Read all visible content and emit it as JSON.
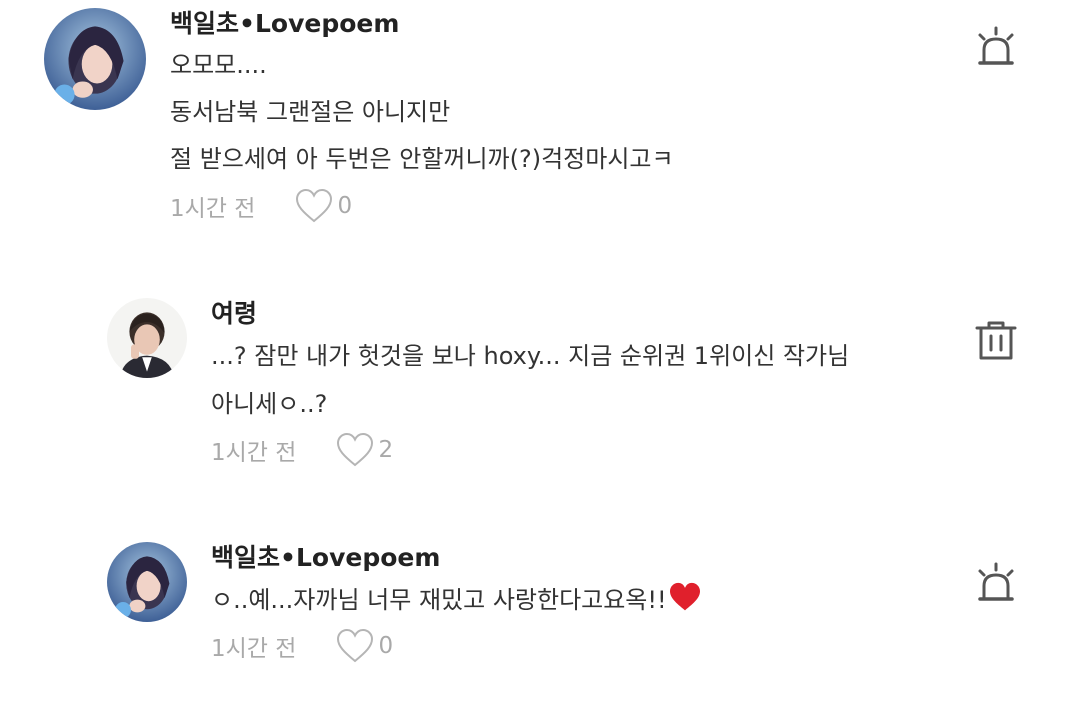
{
  "comments": [
    {
      "author": "백일초•Lovepoem",
      "lines": [
        "오모모....",
        "동서남북 그랜절은 아니지만",
        "절 받으세여 아 두번은 안할꺼니까(?)걱정마시고ㅋ"
      ],
      "time": "1시간 전",
      "likes": "0",
      "action_icon": "report-siren-icon"
    },
    {
      "author": "여령",
      "lines": [
        "...? 잠만 내가 헛것을 보나 hoxy... 지금 순위권 1위이신 작가님",
        "아니세ㅇ..?"
      ],
      "time": "1시간 전",
      "likes": "2",
      "action_icon": "trash-icon"
    },
    {
      "author": "백일초•Lovepoem",
      "lines": [
        "ㅇ..예...자까님 너무 재밌고 사랑한다고요옥!!"
      ],
      "emoji": "heart-emoji",
      "time": "1시간 전",
      "likes": "0",
      "action_icon": "report-siren-icon"
    }
  ],
  "colors": {
    "text": "#333333",
    "muted": "#a9a9a9",
    "icon": "#555555",
    "heart_emoji": "#e0202c"
  }
}
